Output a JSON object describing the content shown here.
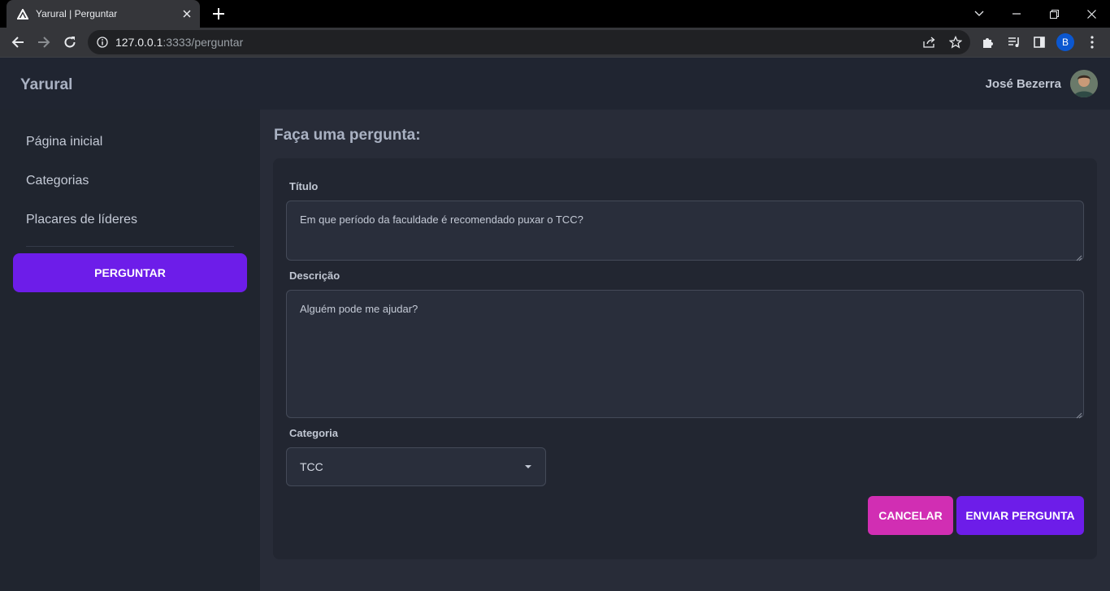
{
  "browser": {
    "tab_title": "Yarural | Perguntar",
    "url_host": "127.0.0.1",
    "url_path": ":3333/perguntar",
    "profile_initial": "B"
  },
  "header": {
    "brand": "Yarural",
    "user_name": "José Bezerra"
  },
  "sidebar": {
    "items": [
      {
        "label": "Página inicial"
      },
      {
        "label": "Categorias"
      },
      {
        "label": "Placares de líderes"
      }
    ],
    "ask_button": "PERGUNTAR"
  },
  "main": {
    "title": "Faça uma pergunta:",
    "form": {
      "title_label": "Título",
      "title_value": "Em que período da faculdade é recomendado puxar o TCC?",
      "description_label": "Descrição",
      "description_value": "Alguém pode me ajudar?",
      "category_label": "Categoria",
      "category_value": "TCC",
      "cancel_button": "CANCELAR",
      "submit_button": "ENVIAR PERGUNTA"
    }
  },
  "colors": {
    "primary": "#6d1de9",
    "cancel": "#d12eb3",
    "background": "#282c38",
    "sidebar": "#20252f"
  }
}
